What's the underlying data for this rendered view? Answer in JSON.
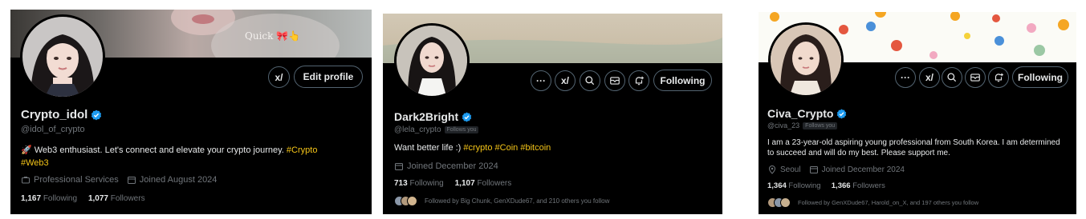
{
  "profiles": [
    {
      "display_name": "Crypto_idol",
      "handle": "@idol_of_crypto",
      "banner_caption": "Quick 🎀👆",
      "buttons": {
        "grok": "x/",
        "edit": "Edit profile"
      },
      "bio_text": "🚀 Web3 enthusiast. Let's connect and elevate your crypto journey. ",
      "bio_tags": [
        "#Crypto",
        "#Web3"
      ],
      "category": "Professional Services",
      "joined": "Joined August 2024",
      "following_count": "1,167",
      "following_label": "Following",
      "followers_count": "1,077",
      "followers_label": "Followers"
    },
    {
      "display_name": "Dark2Bright",
      "handle": "@lela_crypto",
      "follows_you": "Follows you",
      "buttons": {
        "more": "···",
        "grok": "x/",
        "follow": "Following"
      },
      "bio_text": "Want better life :) ",
      "bio_tags": [
        "#crypto",
        "#Coin",
        "#bitcoin"
      ],
      "joined": "Joined December 2024",
      "following_count": "713",
      "following_label": "Following",
      "followers_count": "1,107",
      "followers_label": "Followers",
      "followed_by": "Followed by Big Chunk, GenXDude67, and 210 others you follow"
    },
    {
      "display_name": "Civa_Crypto",
      "handle": "@civa_23",
      "follows_you": "Follows you",
      "buttons": {
        "more": "···",
        "grok": "x/",
        "follow": "Following"
      },
      "bio_line1": "I am a 23-year-old aspiring young professional from South Korea. I am determined",
      "bio_line2": "to succeed and will do my best. Please support me.",
      "location": "Seoul",
      "joined": "Joined December 2024",
      "following_count": "1,364",
      "following_label": "Following",
      "followers_count": "1,366",
      "followers_label": "Followers",
      "followed_by": "Followed by GenXDude67, Harold_on_X, and 197 others you follow"
    }
  ],
  "colors": {
    "background": "#000000",
    "text": "#e7e9ea",
    "muted": "#71767b",
    "hashtag": "#f5c518",
    "verified": "#1d9bf0",
    "border": "#536471"
  }
}
